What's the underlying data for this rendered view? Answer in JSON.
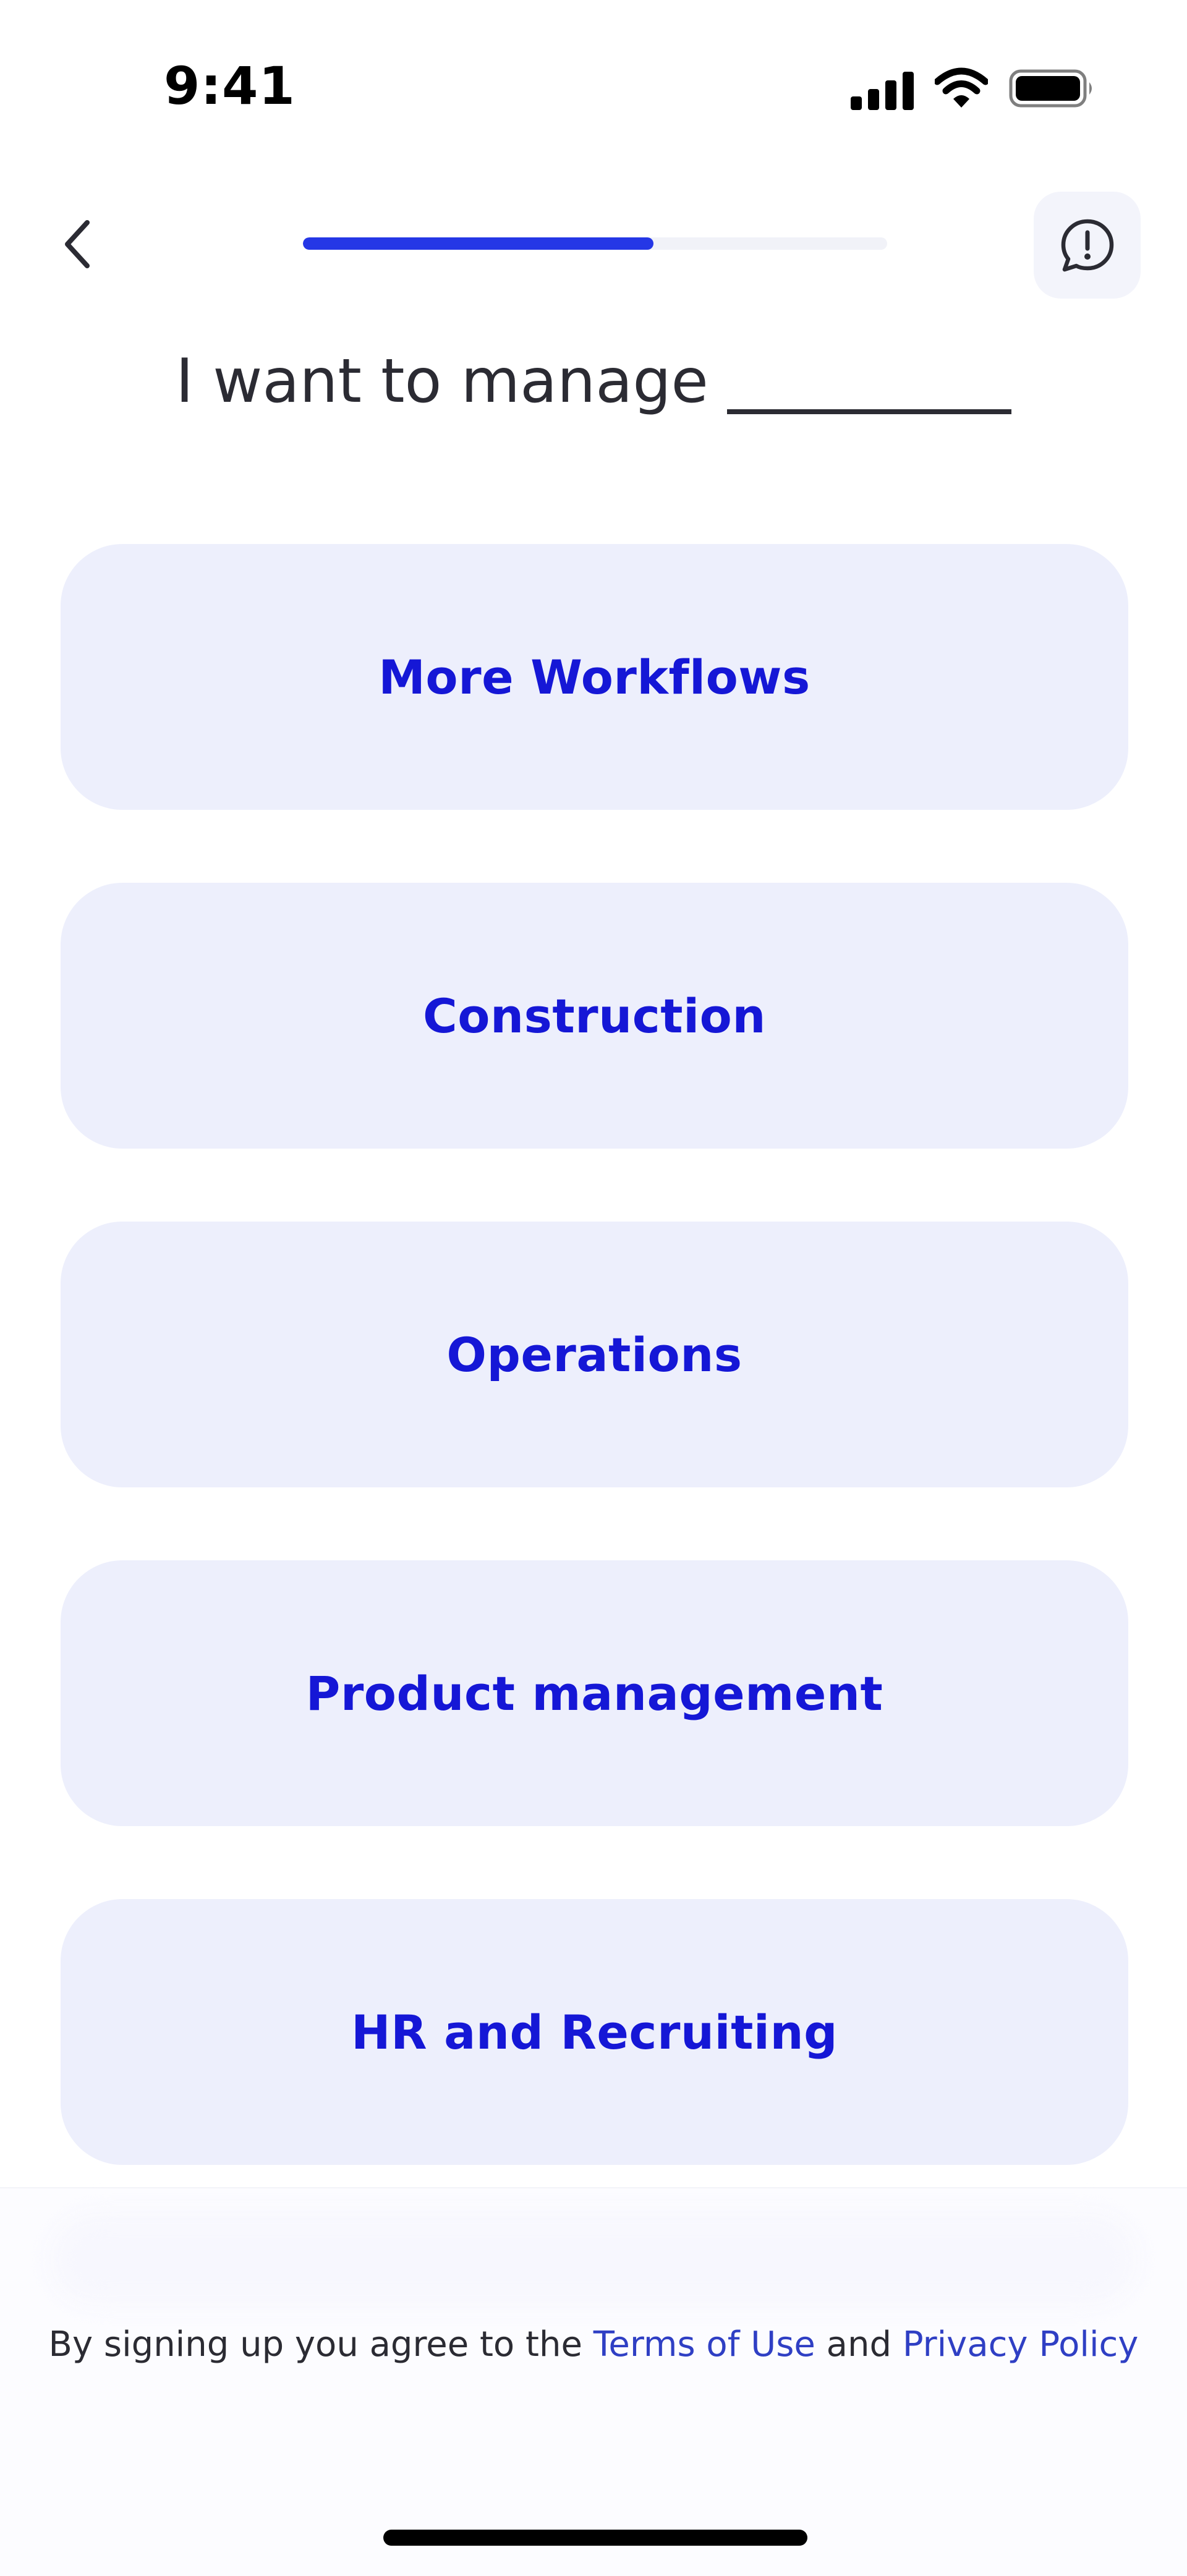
{
  "status_bar": {
    "time": "9:41"
  },
  "header": {
    "progress_fraction": 0.6
  },
  "title": {
    "text": "I want to manage"
  },
  "options": [
    {
      "label": "More Workflows"
    },
    {
      "label": "Construction"
    },
    {
      "label": "Operations"
    },
    {
      "label": "Product management"
    },
    {
      "label": "HR and Recruiting"
    }
  ],
  "footer": {
    "prefix": "By signing up you agree to the",
    "terms_link": "Terms of Use",
    "conjunction": "and",
    "privacy_link": "Privacy Policy"
  },
  "icons": {
    "back": "chevron-left-icon",
    "feedback": "alert-chat-bubble-icon",
    "signal": "cellular-signal-icon",
    "wifi": "wifi-icon",
    "battery": "battery-icon"
  },
  "colors": {
    "accent": "#2537e6",
    "option_bg": "#edeffc",
    "option_text": "#1517d6",
    "link": "#2f3fc4"
  }
}
